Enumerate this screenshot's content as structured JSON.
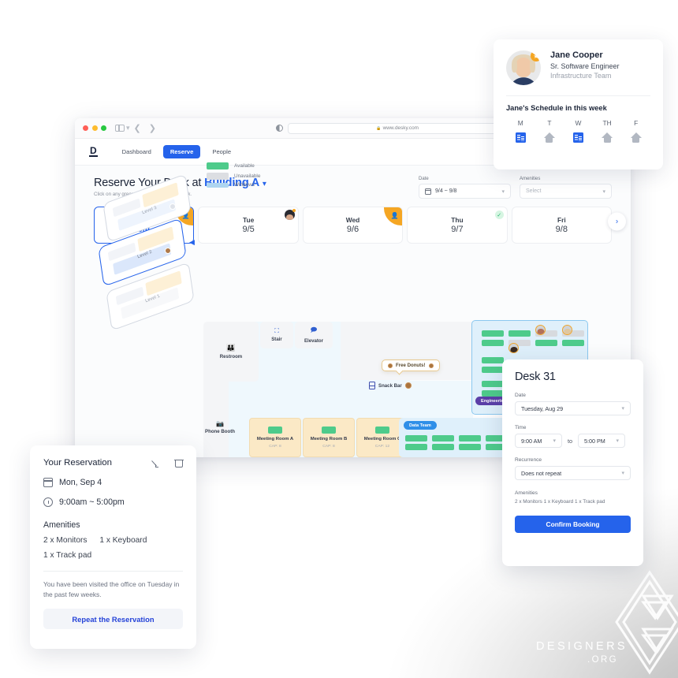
{
  "browser": {
    "url": "www.desky.com",
    "lock_icon": "lock-icon",
    "reload_icon": "reload-icon",
    "back_icon": "chevron-left-icon",
    "forward_icon": "chevron-right-icon",
    "sidebar_icon": "sidebar-toggle-icon"
  },
  "nav": {
    "logo": "D",
    "items": [
      {
        "label": "Dashboard",
        "active": false
      },
      {
        "label": "Reserve",
        "active": true
      },
      {
        "label": "People",
        "active": false
      }
    ]
  },
  "page_head": {
    "title_prefix": "Reserve Your Desk at",
    "building": "Building A",
    "caret": "⌄",
    "subtitle": "Click on any green spot to reserve your desk."
  },
  "filters": [
    {
      "label": "Date",
      "value": "9/4 ~ 9/8",
      "icon": "calendar-icon",
      "placeholder": false
    },
    {
      "label": "Amenities",
      "value": "Select",
      "icon": "",
      "placeholder": true
    }
  ],
  "days": [
    {
      "name": "Mon",
      "today": "(Today)",
      "date": "9/4",
      "selected": true,
      "marker": "orange-corner-person"
    },
    {
      "name": "Tue",
      "today": "",
      "date": "9/5",
      "selected": false,
      "marker": "avatar"
    },
    {
      "name": "Wed",
      "today": "",
      "date": "9/6",
      "selected": false,
      "marker": "orange-corner-avatar"
    },
    {
      "name": "Thu",
      "today": "",
      "date": "9/7",
      "selected": false,
      "marker": "check"
    },
    {
      "name": "Fri",
      "today": "",
      "date": "9/8",
      "selected": false,
      "marker": ""
    }
  ],
  "next_day_arrow": "›",
  "legend": [
    {
      "label": "Available",
      "color": "#4ecb8b"
    },
    {
      "label": "Unavailable",
      "color": "#dcdee2"
    },
    {
      "label": "Windows",
      "color": "#aed5f0"
    }
  ],
  "levels": [
    {
      "label": "Level 3",
      "active": false
    },
    {
      "label": "Level 2",
      "active": true
    },
    {
      "label": "Level 1",
      "active": false
    }
  ],
  "map": {
    "rooms": [
      {
        "name": "Restroom",
        "icon": "restroom-icon"
      },
      {
        "name": "Stair",
        "icon": "stair-icon"
      },
      {
        "name": "Elevator",
        "icon": "elevator-icon"
      },
      {
        "name": "Phone Booth",
        "icon": "phone-booth-icon"
      }
    ],
    "meeting_rooms": [
      {
        "name": "Meeting Room A",
        "cap": "CAP: 8"
      },
      {
        "name": "Meeting Room B",
        "cap": "CAP: 8"
      },
      {
        "name": "Meeting Room C",
        "cap": "CAP: 12"
      }
    ],
    "zones": [
      {
        "name": "Engineering",
        "color": "#5b3fa8"
      },
      {
        "name": "Data Team",
        "color": "#2f8fe8"
      }
    ],
    "snack_bar": {
      "label": "Snack Bar",
      "icon": "snack-bar-icon"
    },
    "tooltip": {
      "label": "Free Donuts!",
      "icon": "donut-icon"
    }
  },
  "profile": {
    "name": "Jane Cooper",
    "role": "Sr. Software Engineer",
    "team": "Infrastructure Team",
    "star_icon": "star-badge-icon",
    "schedule_title": "Jane's Schedule in this week",
    "schedule": [
      {
        "day": "M",
        "mode": "office"
      },
      {
        "day": "T",
        "mode": "home"
      },
      {
        "day": "W",
        "mode": "office"
      },
      {
        "day": "TH",
        "mode": "home"
      },
      {
        "day": "F",
        "mode": "home"
      }
    ]
  },
  "reservation": {
    "title": "Your Reservation",
    "edit_icon": "pencil-icon",
    "delete_icon": "trash-icon",
    "date": "Mon, Sep 4",
    "time": "9:00am ~ 5:00pm",
    "amenities_title": "Amenities",
    "amenities_line1": [
      "2 x  Monitors",
      "1 x  Keyboard"
    ],
    "amenities_line2": [
      "1 x  Track pad"
    ],
    "note": "You have been visited the office on Tuesday in the past few weeks.",
    "repeat_button": "Repeat the Reservation"
  },
  "desk_panel": {
    "title": "Desk 31",
    "date_label": "Date",
    "date_value": "Tuesday, Aug 29",
    "time_label": "Time",
    "time_start": "9:00 AM",
    "time_to": "to",
    "time_end": "5:00 PM",
    "recurrence_label": "Recurrence",
    "recurrence_value": "Does not repeat",
    "amenities_label": "Amenities",
    "amenities_value": "2 x  Monitors    1 x  Keyboard    1 x  Track pad",
    "confirm_button": "Confirm Booking",
    "caret": "⌄"
  },
  "watermark": {
    "name": "DESIGNERS",
    "tld": ".ORG"
  }
}
